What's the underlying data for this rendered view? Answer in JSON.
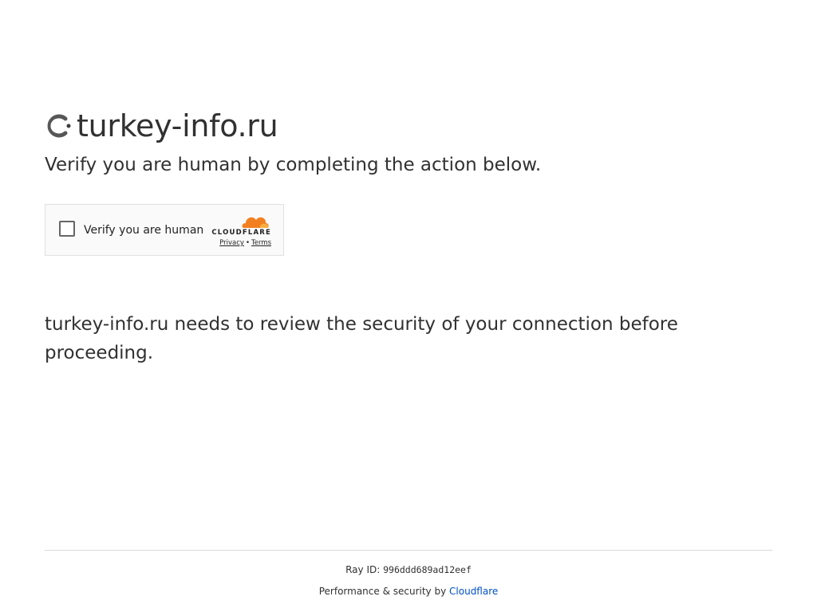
{
  "header": {
    "site_name": "turkey-info.ru",
    "icon": "loading-spinner-icon"
  },
  "subtitle": "Verify you are human by completing the action below.",
  "widget": {
    "checkbox_label": "Verify you are human",
    "brand_logo": "cloudflare-cloud-icon",
    "brand_wordmark": "CLOUDFLARE",
    "privacy_link": "Privacy",
    "separator": "•",
    "terms_link": "Terms",
    "checked": false
  },
  "message": "turkey-info.ru needs to review the security of your connection before proceeding.",
  "footer": {
    "ray_label": "Ray ID:",
    "ray_id": "996ddd689ad12eef",
    "perf_prefix": "Performance & security by",
    "perf_link": "Cloudflare"
  },
  "colors": {
    "text": "#313131",
    "link": "#0051c3",
    "cloudflare_orange": "#f38020",
    "cloudflare_light": "#faae40"
  }
}
